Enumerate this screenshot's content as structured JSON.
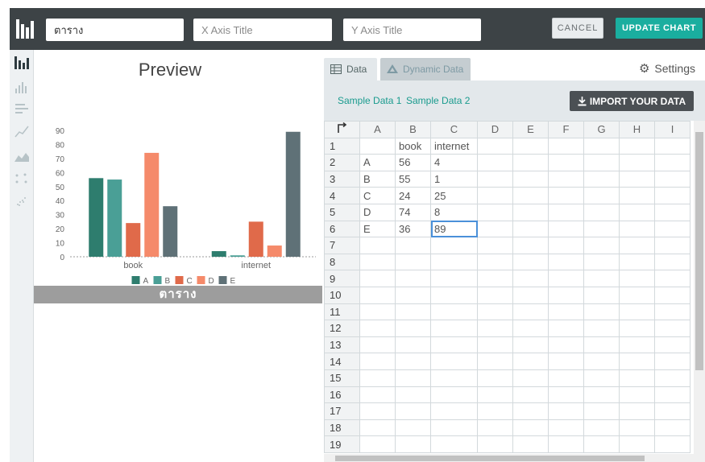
{
  "topbar": {
    "title_value": "ตาราง",
    "x_axis_placeholder": "X Axis Title",
    "y_axis_placeholder": "Y Axis Title",
    "cancel_label": "CANCEL",
    "update_label": "UPDATE CHART"
  },
  "sidebar": {
    "items": [
      {
        "icon": "column-chart-icon"
      },
      {
        "icon": "histogram-icon"
      },
      {
        "icon": "bar-chart-icon"
      },
      {
        "icon": "line-chart-icon"
      },
      {
        "icon": "area-chart-icon"
      },
      {
        "icon": "scatter-chart-icon"
      },
      {
        "icon": "bubble-chart-icon"
      }
    ]
  },
  "preview": {
    "title": "Preview",
    "caption": "ตาราง"
  },
  "chart_data": {
    "type": "bar",
    "categories": [
      "book",
      "internet"
    ],
    "series": [
      {
        "name": "A",
        "values": [
          56,
          4
        ],
        "color": "#2e7d6e"
      },
      {
        "name": "B",
        "values": [
          55,
          1
        ],
        "color": "#4a9f96"
      },
      {
        "name": "C",
        "values": [
          24,
          25
        ],
        "color": "#e06a4a"
      },
      {
        "name": "D",
        "values": [
          74,
          8
        ],
        "color": "#f58a6a"
      },
      {
        "name": "E",
        "values": [
          36,
          89
        ],
        "color": "#5f7177"
      }
    ],
    "yticks": [
      0,
      10,
      20,
      30,
      40,
      50,
      60,
      70,
      80,
      90
    ],
    "ylim": [
      0,
      90
    ],
    "legend": "bottom-center"
  },
  "panel": {
    "tab_data": "Data",
    "tab_dynamic": "Dynamic Data",
    "settings": "Settings",
    "sample1": "Sample Data 1",
    "sample2": "Sample Data 2",
    "import": "IMPORT YOUR DATA"
  },
  "grid": {
    "columns": [
      "A",
      "B",
      "C",
      "D",
      "E",
      "F",
      "G",
      "H",
      "I"
    ],
    "rows": [
      [
        "1",
        "",
        "book",
        "internet"
      ],
      [
        "2",
        "A",
        "56",
        "4"
      ],
      [
        "3",
        "B",
        "55",
        "1"
      ],
      [
        "4",
        "C",
        "24",
        "25"
      ],
      [
        "5",
        "D",
        "74",
        "8"
      ],
      [
        "6",
        "E",
        "36",
        "89"
      ],
      [
        "7"
      ],
      [
        "8"
      ],
      [
        "9"
      ],
      [
        "10"
      ],
      [
        "11"
      ],
      [
        "12"
      ],
      [
        "13"
      ],
      [
        "14"
      ],
      [
        "15"
      ],
      [
        "16"
      ],
      [
        "17"
      ],
      [
        "18"
      ],
      [
        "19"
      ]
    ]
  },
  "colors": {
    "accent": "#1aae9f",
    "topbar": "#3d4346"
  }
}
